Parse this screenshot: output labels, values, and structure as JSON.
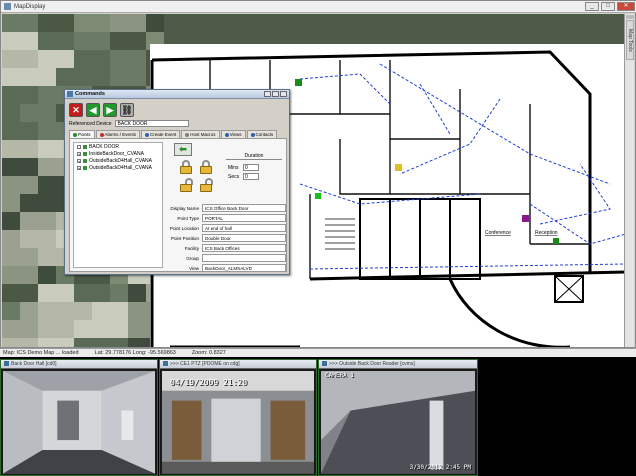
{
  "window": {
    "title": "MapDisplay",
    "minimize": "_",
    "maximize": "□",
    "close": "✕"
  },
  "side_tab": {
    "label": "Map Tools"
  },
  "status": {
    "map": "Map: ICS Demo Map ... loaded",
    "lat_long": "Lat: 29.778176  Long: -95.569863",
    "zoom": "Zoom: 0.8327"
  },
  "map_labels": {
    "conference": "Conference",
    "reception": "Reception"
  },
  "commands": {
    "title": "Commands",
    "referenced_label": "Referenced Device",
    "referenced_value": "BACK DOOR",
    "tabs": [
      {
        "label": "Points",
        "color": "#2a8a2a"
      },
      {
        "label": "Alarms / Events",
        "color": "#c23030"
      },
      {
        "label": "Create Event",
        "color": "#3060b0"
      },
      {
        "label": "Host Macros",
        "color": "#808080"
      },
      {
        "label": "Views",
        "color": "#3060b0"
      },
      {
        "label": "Contacts",
        "color": "#3060b0"
      }
    ],
    "tree": [
      {
        "label": "BACK DOOR",
        "expander": "-"
      },
      {
        "label": "InsideBackDoor_CVANA",
        "expander": "+"
      },
      {
        "label": "OutsideBackD4Hall_CVANA",
        "expander": "+"
      },
      {
        "label": "OutsideBackD4Hall_CVANA",
        "expander": "+"
      }
    ],
    "duration": {
      "heading": "Duration",
      "mins_label": "Mins",
      "mins_value": "0",
      "secs_label": "Secs",
      "secs_value": "0"
    },
    "properties": [
      {
        "label": "Display Name",
        "value": "ICS Office Back Door"
      },
      {
        "label": "Point Type",
        "value": "PORTAL"
      },
      {
        "label": "Point Location",
        "value": "At end of hall"
      },
      {
        "label": "Point Position",
        "value": "Double Door"
      },
      {
        "label": "Facility",
        "value": "ICS Back Offices"
      },
      {
        "label": "Group",
        "value": ""
      },
      {
        "label": "View",
        "value": "BackDoor_ALMSALVD"
      }
    ]
  },
  "cameras": [
    {
      "title": "Back Door Hall [cd0]",
      "overlay": ""
    },
    {
      "title": ">>> CE1 PTZ [PDOME on cdg]",
      "overlay": "04/19/2009 21:20"
    },
    {
      "title": ">>> Outside Back Door Reader [cvms]",
      "overlay_top": "CAMERA 1",
      "overlay": "3/30/2012 2:45 PM"
    }
  ]
}
